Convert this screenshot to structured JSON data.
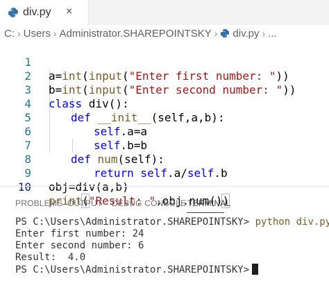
{
  "tab": {
    "filename": "div.py",
    "close_glyph": "×",
    "icon": "python-icon"
  },
  "breadcrumb": {
    "items": [
      "C:",
      "Users",
      "Administrator.SHAREPOINTSKY",
      "div.py",
      "..."
    ],
    "separator": "›",
    "file_icon": "python-icon"
  },
  "editor": {
    "active_line": 10,
    "lines": [
      {
        "number": "1"
      },
      {
        "number": "2"
      },
      {
        "number": "3"
      },
      {
        "number": "4"
      },
      {
        "number": "5"
      },
      {
        "number": "6"
      },
      {
        "number": "7"
      },
      {
        "number": "8"
      },
      {
        "number": "9"
      },
      {
        "number": "10"
      }
    ],
    "tokens": {
      "l1": [
        "a=",
        "int",
        "(",
        "input",
        "(",
        "\"Enter first number: \"",
        "))"
      ],
      "l2": [
        "b=",
        "int",
        "(",
        "input",
        "(",
        "\"Enter second number: \"",
        "))"
      ],
      "l3": [
        "class",
        " div():"
      ],
      "l4": [
        "def",
        " ",
        "__init__",
        "(self,a,b):"
      ],
      "l5": [
        "self",
        ".a=a"
      ],
      "l6": [
        "self",
        ".b=b"
      ],
      "l7": [
        "def",
        " ",
        "num",
        "(self):"
      ],
      "l8": [
        "return",
        " ",
        "self",
        ".a/",
        "self",
        ".b"
      ],
      "l9": [
        "obj=div(a,b)"
      ],
      "l10": [
        "print",
        "(",
        "\"Result: \"",
        ",obj.num()",
        ")"
      ]
    }
  },
  "panel": {
    "tabs": [
      "PROBLEMS",
      "OUTPUT",
      "DEBUG CONSOLE",
      "TERMINAL"
    ],
    "active_tab": "TERMINAL"
  },
  "terminal": {
    "prompt": "PS C:\\Users\\Administrator.SHAREPOINTSKY>",
    "command": "python div.py",
    "output": [
      "Enter first number: 24",
      "Enter second number: 6",
      "Result:  4.0"
    ]
  },
  "colors": {
    "keyword": "#0000ff",
    "string": "#a31515",
    "function": "#795e26",
    "line_number": "#237893",
    "line_number_active": "#0b216f"
  }
}
